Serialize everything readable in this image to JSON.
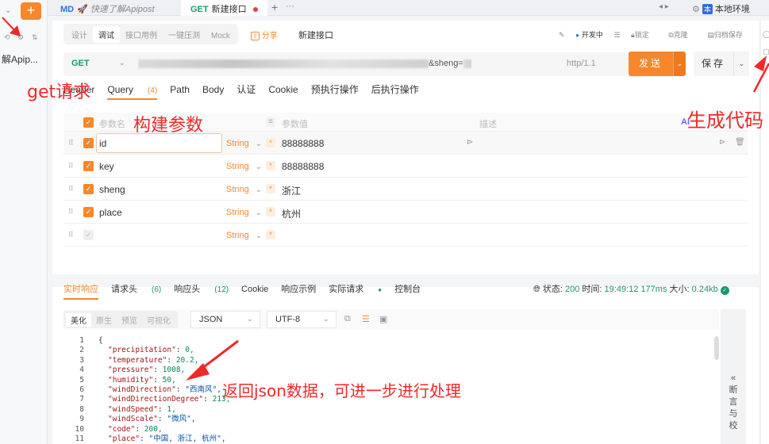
{
  "sidebar": {
    "add_label": "+",
    "project_label": "解Apip..."
  },
  "tabs": [
    {
      "tag": "MD",
      "title": "快速了解Apipost"
    },
    {
      "method": "GET",
      "title": "新建接口"
    }
  ],
  "tabbar": {
    "add": "+",
    "more": "···",
    "nav": "◂ ▸",
    "env_badge": "本",
    "env": "本地环境"
  },
  "modebar": {
    "modes": [
      "设计",
      "调试",
      "接口用例",
      "一键压测",
      "Mock"
    ],
    "active_mode": "调试",
    "share": "分享",
    "api_name": "新建接口",
    "env_select": "开发中",
    "actions": [
      "锁定",
      "克隆",
      "归档保存"
    ]
  },
  "url_bar": {
    "method": "GET",
    "url_visible": "&sheng=",
    "protocol": "http/1.1",
    "send_label": "发送",
    "save_label": "保存"
  },
  "request_tabs": [
    {
      "label": "Header"
    },
    {
      "label": "Query",
      "count": "(4)",
      "active": true
    },
    {
      "label": "Path"
    },
    {
      "label": "Body"
    },
    {
      "label": "认证"
    },
    {
      "label": "Cookie"
    },
    {
      "label": "预执行操作"
    },
    {
      "label": "后执行操作"
    }
  ],
  "params": {
    "headers": {
      "name": "参数名",
      "value": "参数值",
      "desc": "描述",
      "ai": "AI"
    },
    "rows": [
      {
        "name": "id",
        "type": "String",
        "value": "88888888"
      },
      {
        "name": "key",
        "type": "String",
        "value": "88888888"
      },
      {
        "name": "sheng",
        "type": "String",
        "value": "浙江"
      },
      {
        "name": "place",
        "type": "String",
        "value": "杭州"
      },
      {
        "name": "",
        "type": "String",
        "value": ""
      }
    ]
  },
  "response_tabs": [
    {
      "label": "实时响应",
      "active": true
    },
    {
      "label": "请求头",
      "count": "(6)"
    },
    {
      "label": "响应头",
      "count": "(12)"
    },
    {
      "label": "Cookie"
    },
    {
      "label": "响应示例"
    },
    {
      "label": "实际请求",
      "live": "●"
    },
    {
      "label": "控制台"
    }
  ],
  "status": {
    "status_label": "状态:",
    "status_code": "200",
    "time_label": "时间:",
    "time": "19:49:12",
    "duration": "177ms",
    "size_label": "大小:",
    "size": "0.24kb"
  },
  "view_bar": {
    "views": [
      "美化",
      "原生",
      "预览",
      "可视化"
    ],
    "active_view": "美化",
    "format": "JSON",
    "encoding": "UTF-8"
  },
  "code_lines": [
    {
      "n": "1",
      "raw": "{"
    },
    {
      "n": "2",
      "key": "\"precipitation\"",
      "val": "0,",
      "vtype": "n"
    },
    {
      "n": "3",
      "key": "\"temperature\"",
      "val": "20.2,",
      "vtype": "n"
    },
    {
      "n": "4",
      "key": "\"pressure\"",
      "val": "1008,",
      "vtype": "n"
    },
    {
      "n": "5",
      "key": "\"humidity\"",
      "val": "50,",
      "vtype": "n"
    },
    {
      "n": "6",
      "key": "\"windDirection\"",
      "val": "\"西南风\",",
      "vtype": "s"
    },
    {
      "n": "7",
      "key": "\"windDirectionDegree\"",
      "val": "213,",
      "vtype": "n"
    },
    {
      "n": "8",
      "key": "\"windSpeed\"",
      "val": "1,",
      "vtype": "n"
    },
    {
      "n": "9",
      "key": "\"windScale\"",
      "val": "\"微风\",",
      "vtype": "s"
    },
    {
      "n": "10",
      "key": "\"code\"",
      "val": "200,",
      "vtype": "n"
    },
    {
      "n": "11",
      "key": "\"place\"",
      "val": "\"中国, 浙江, 杭州\",",
      "vtype": "s"
    }
  ],
  "assert_panel": {
    "chevron": "«",
    "label": "断言与校"
  },
  "annotations": {
    "get": "get请求",
    "params": "构建参数",
    "gen_code": "生成代码",
    "json": "返回json数据，可进一步进行处理"
  },
  "colors": {
    "accent": "#f7872a",
    "get_green": "#1a9a6a",
    "annotation_red": "#f02828"
  }
}
